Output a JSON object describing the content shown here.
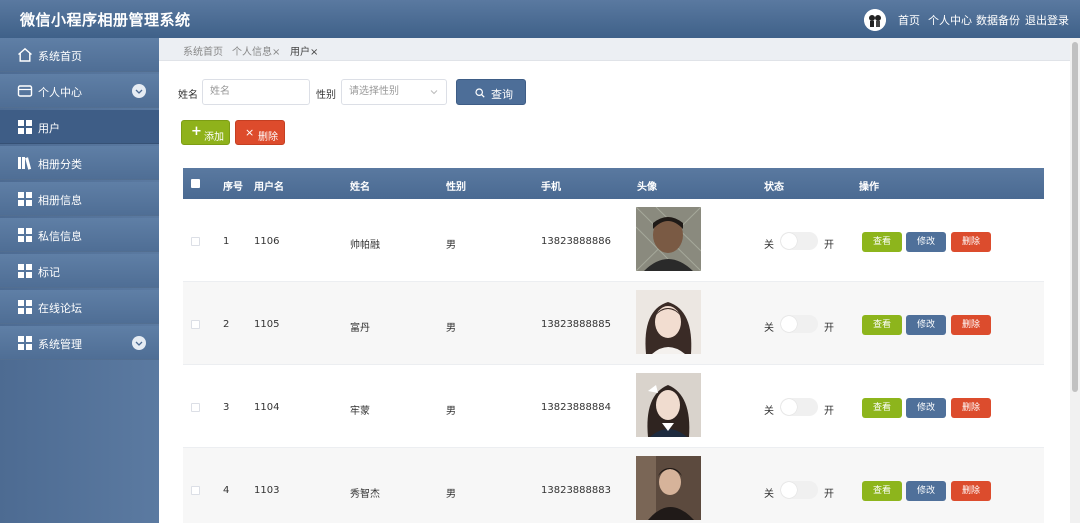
{
  "header": {
    "title": "微信小程序相册管理系统",
    "nav": [
      "首页",
      "个人中心",
      "数据备份",
      "退出登录"
    ]
  },
  "sidebar": {
    "items": [
      {
        "label": "系统首页",
        "icon": "home-icon"
      },
      {
        "label": "个人中心",
        "icon": "card-icon",
        "expandable": true
      },
      {
        "label": "用户",
        "icon": "grid-icon",
        "active": true
      },
      {
        "label": "相册分类",
        "icon": "books-icon"
      },
      {
        "label": "相册信息",
        "icon": "grid-icon"
      },
      {
        "label": "私信信息",
        "icon": "grid-icon"
      },
      {
        "label": "标记",
        "icon": "grid-icon"
      },
      {
        "label": "在线论坛",
        "icon": "grid-icon"
      },
      {
        "label": "系统管理",
        "icon": "grid-icon",
        "expandable": true
      }
    ]
  },
  "breadcrumbs": [
    "系统首页",
    "个人信息×",
    "用户×"
  ],
  "search": {
    "name_label": "姓名",
    "name_placeholder": "姓名",
    "gender_label": "性别",
    "gender_placeholder": "请选择性别",
    "query_label": "查询"
  },
  "actions": {
    "add_label": "添加",
    "delete_label": "删除"
  },
  "table": {
    "columns": [
      "序号",
      "用户名",
      "姓名",
      "性别",
      "手机",
      "头像",
      "状态",
      "操作"
    ],
    "switch_off": "关",
    "switch_on": "开",
    "row_actions": {
      "view": "查看",
      "edit": "修改",
      "delete": "删除"
    },
    "rows": [
      {
        "index": "1",
        "username": "1106",
        "name": "帅帕融",
        "gender": "男",
        "phone": "13823888886",
        "status_on": false
      },
      {
        "index": "2",
        "username": "1105",
        "name": "富丹",
        "gender": "男",
        "phone": "13823888885",
        "status_on": false
      },
      {
        "index": "3",
        "username": "1104",
        "name": "牢蒙",
        "gender": "男",
        "phone": "13823888884",
        "status_on": false
      },
      {
        "index": "4",
        "username": "1103",
        "name": "秀智杰",
        "gender": "男",
        "phone": "13823888883",
        "status_on": false
      }
    ]
  },
  "colors": {
    "header": "#4a6a92",
    "add": "#8fb21b",
    "delete": "#dd4b2c",
    "edit": "#4f709a"
  }
}
